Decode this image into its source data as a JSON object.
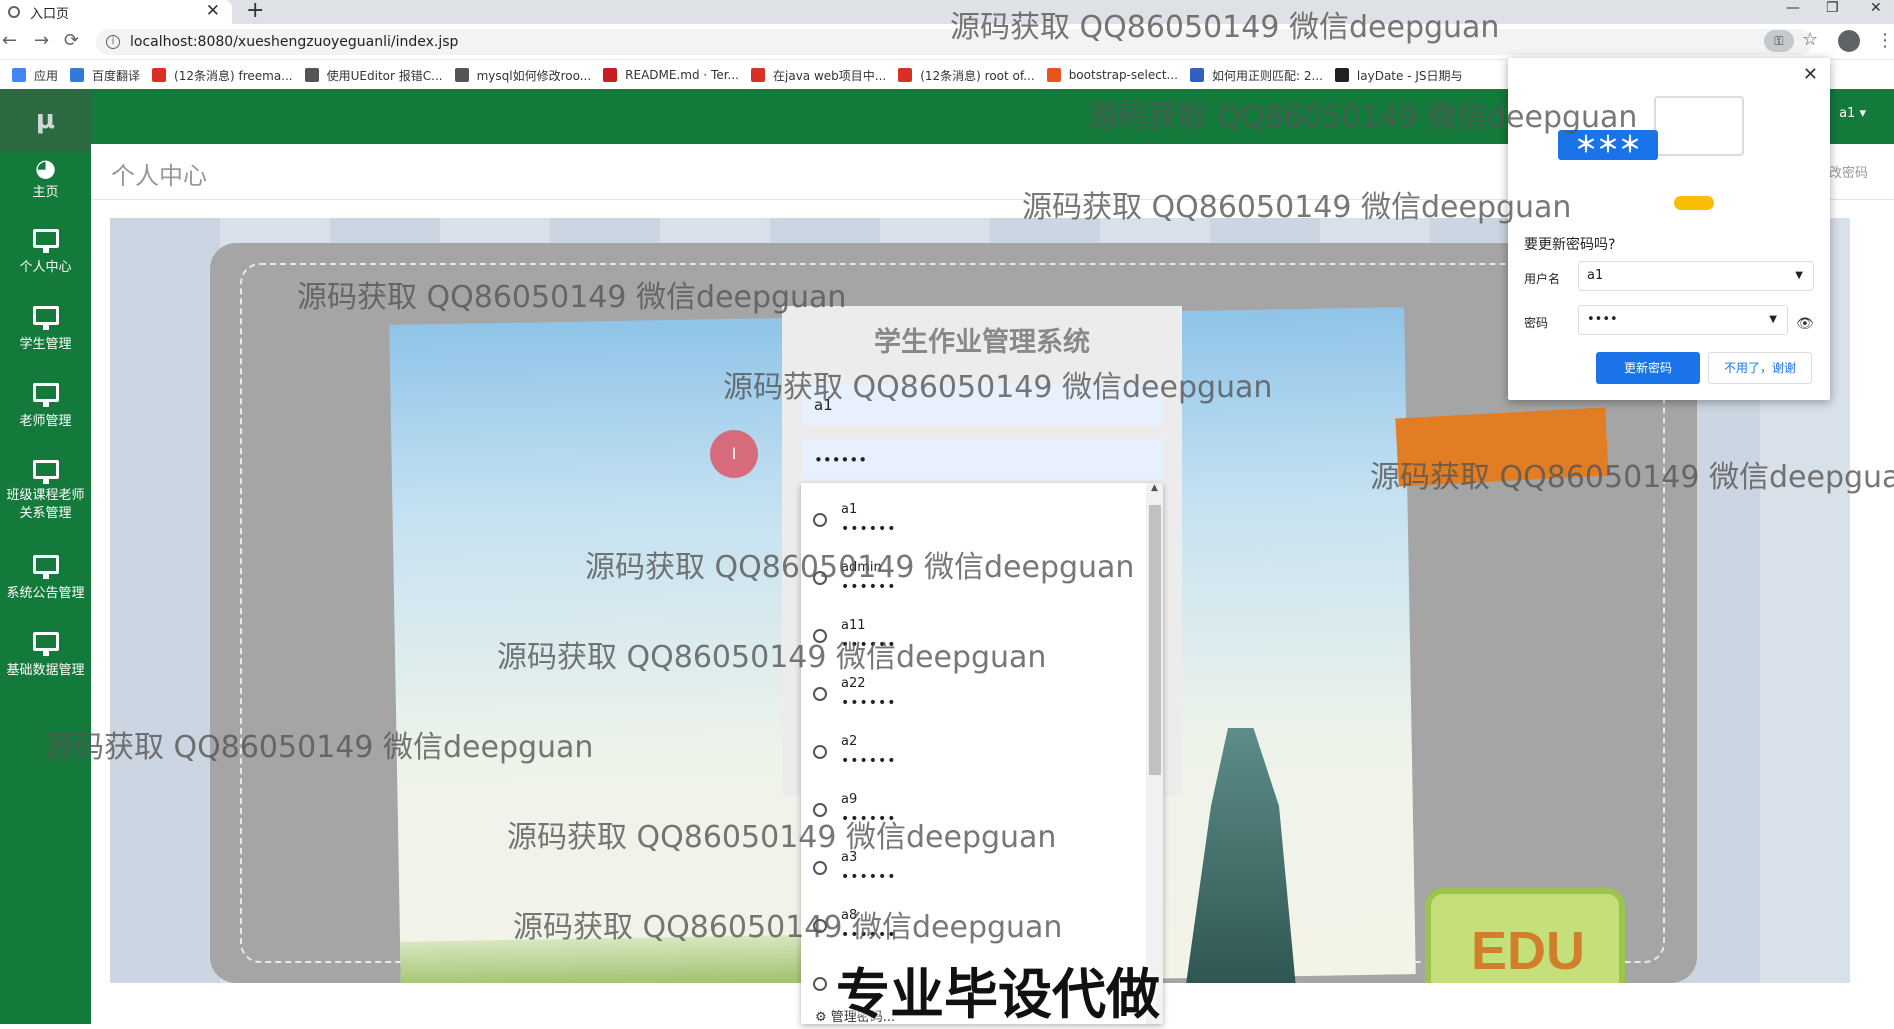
{
  "browser": {
    "tab_title": "入口页",
    "url": "localhost:8080/xueshengzuoyeguanli/index.jsp",
    "bookmarks": [
      {
        "label": "应用",
        "color": "#4285f4"
      },
      {
        "label": "百度翻译",
        "color": "#2f7bd9"
      },
      {
        "label": "(12条消息) freema...",
        "color": "#d93025"
      },
      {
        "label": "使用UEditor 报错C...",
        "color": "#555555"
      },
      {
        "label": "mysql如何修改roo...",
        "color": "#555555"
      },
      {
        "label": "README.md · Ter...",
        "color": "#c71d23"
      },
      {
        "label": "在java web项目中...",
        "color": "#d93025"
      },
      {
        "label": "(12条消息) root of...",
        "color": "#d93025"
      },
      {
        "label": "bootstrap-select...",
        "color": "#e8531e"
      },
      {
        "label": "如何用正则匹配: 2...",
        "color": "#3060c0"
      },
      {
        "label": "layDate - JS日期与",
        "color": "#222222"
      }
    ]
  },
  "app": {
    "logo": "μ",
    "user": "a1 ▾",
    "page_title": "个人中心",
    "change_password": "修改密码",
    "nav": [
      {
        "label": "主页",
        "icon": "dashboard-icon"
      },
      {
        "label": "个人中心",
        "icon": "monitor-icon"
      },
      {
        "label": "学生管理",
        "icon": "monitor-icon"
      },
      {
        "label": "老师管理",
        "icon": "monitor-icon"
      },
      {
        "label": "班级课程老师关系管理",
        "icon": "monitor-icon"
      },
      {
        "label": "系统公告管理",
        "icon": "monitor-icon"
      },
      {
        "label": "基础数据管理",
        "icon": "monitor-icon"
      }
    ],
    "colors": {
      "sidebar": "#137a3c",
      "accent": "#1a73e8"
    }
  },
  "login": {
    "title": "学生作业管理系统",
    "username_value": "a1",
    "password_value": "••••••"
  },
  "autofill": {
    "items": [
      {
        "user": "a1",
        "pass": "••••••"
      },
      {
        "user": "admin",
        "pass": "••••••"
      },
      {
        "user": "a11",
        "pass": "••••••"
      },
      {
        "user": "a22",
        "pass": "••••••"
      },
      {
        "user": "a2",
        "pass": "••••••"
      },
      {
        "user": "a9",
        "pass": "••••••"
      },
      {
        "user": "a3",
        "pass": "••••••"
      },
      {
        "user": "a8",
        "pass": "••••••"
      },
      {
        "user": "",
        "pass": ""
      }
    ],
    "manage": "管理密码..."
  },
  "password_popup": {
    "question": "要更新密码吗?",
    "username_label": "用户名",
    "username_value": "a1",
    "password_label": "密码",
    "password_value": "••••",
    "stars": "＊＊＊",
    "update_button": "更新密码",
    "decline_button": "不用了，谢谢"
  },
  "watermarks": {
    "text": "源码获取 QQ86050149 微信deepguan",
    "promo": "专业毕设代做"
  }
}
